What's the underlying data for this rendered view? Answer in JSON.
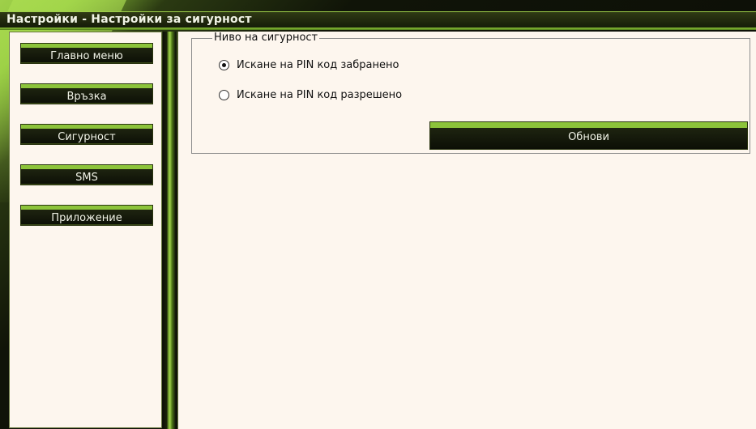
{
  "window": {
    "title": "Настройки - Настройки за сигурност"
  },
  "sidebar": {
    "items": [
      {
        "label": "Главно меню"
      },
      {
        "label": "Връзка"
      },
      {
        "label": "Сигурност"
      },
      {
        "label": "SMS"
      },
      {
        "label": "Приложение"
      }
    ]
  },
  "security": {
    "group_label": "Ниво на сигурност",
    "options": [
      {
        "label": "Искане на PIN код забранено",
        "checked": true
      },
      {
        "label": "Искане на PIN код разрешено",
        "checked": false
      }
    ],
    "update_label": "Обнови"
  },
  "colors": {
    "accent": "#8cc33a",
    "dark": "#0c0f06",
    "panel": "#fdf6ee"
  }
}
